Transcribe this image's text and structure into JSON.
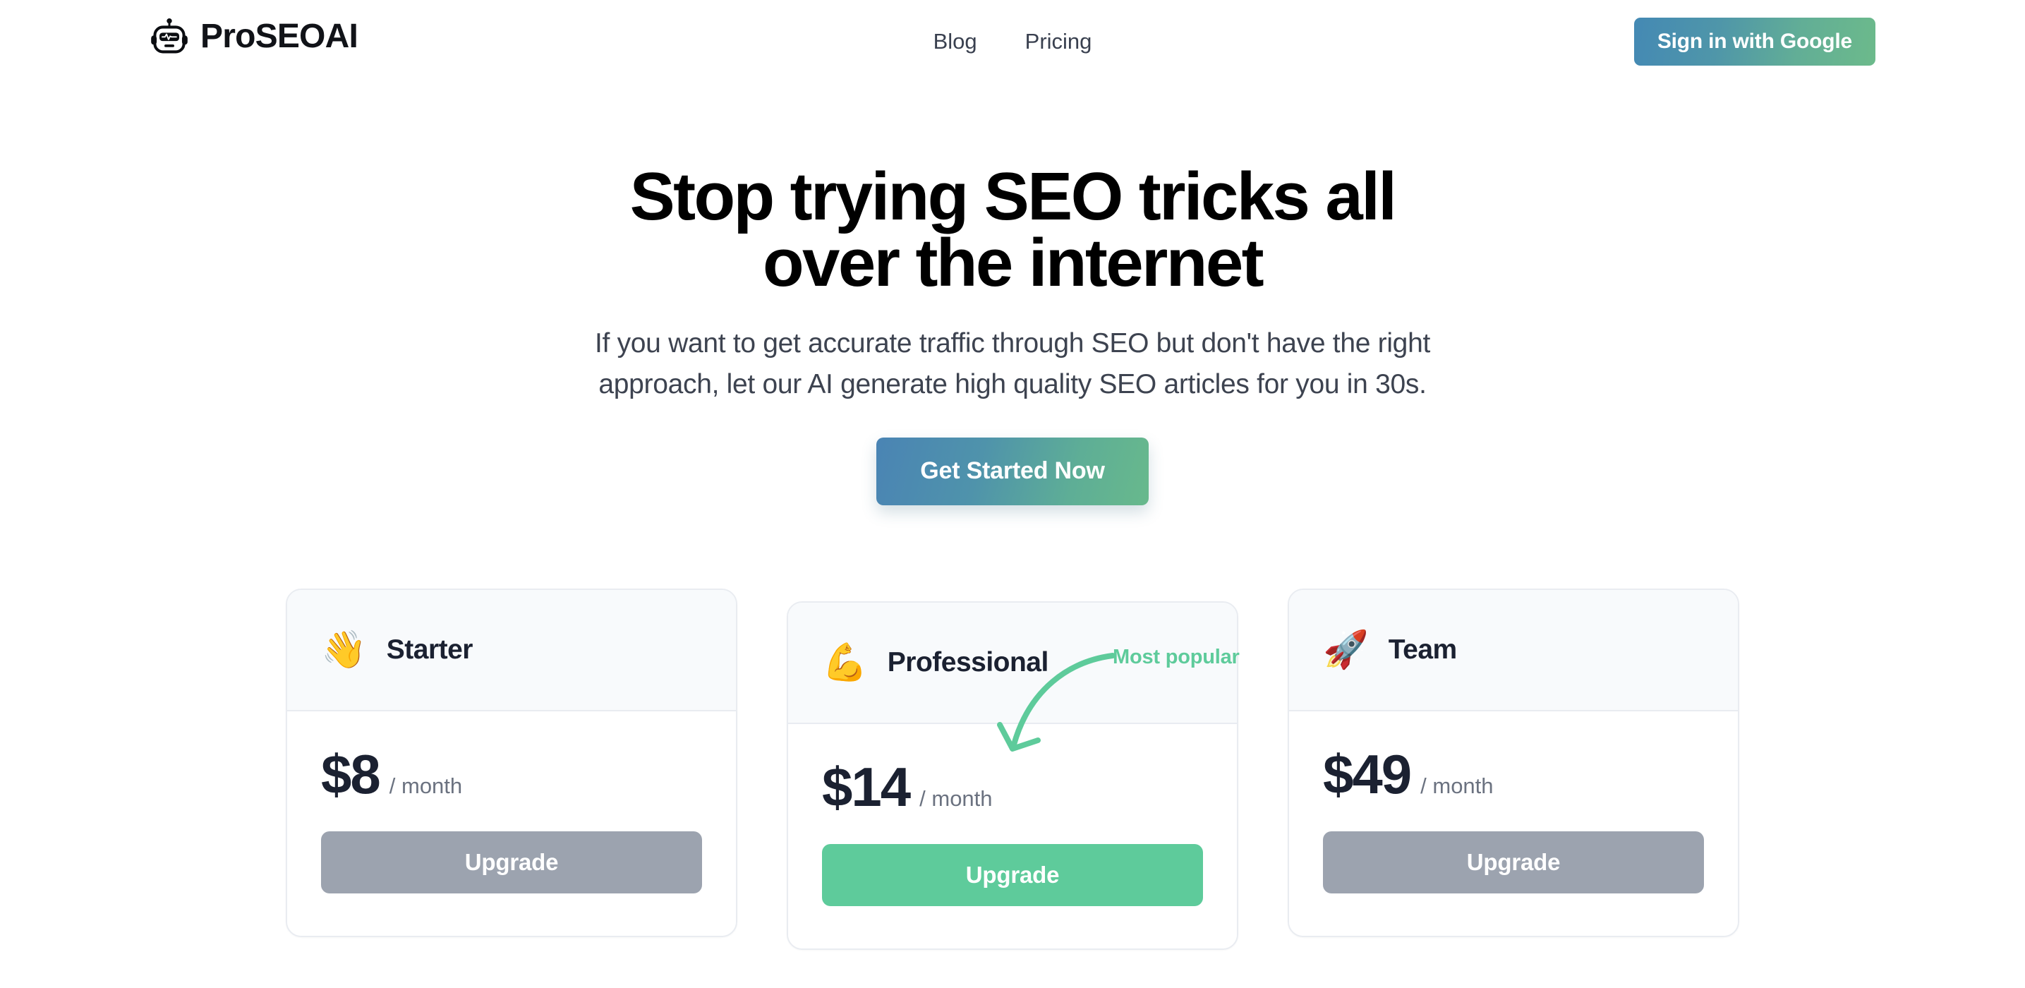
{
  "brand": {
    "name": "ProSEOAI",
    "logo_icon": "robot-head-icon"
  },
  "header": {
    "nav": [
      {
        "label": "Blog"
      },
      {
        "label": "Pricing"
      }
    ],
    "signin_label": "Sign in with Google"
  },
  "hero": {
    "title": "Stop trying SEO tricks all over the internet",
    "subtitle": "If you want to get accurate traffic through SEO but don't have the right approach, let our AI generate high quality SEO articles for you in 30s.",
    "cta_label": "Get Started Now"
  },
  "pricing": {
    "popular_badge": "Most popular",
    "plans": [
      {
        "emoji": "👋",
        "emoji_name": "waving-hand-emoji",
        "name": "Starter",
        "price": "$8",
        "period": "/ month",
        "button_label": "Upgrade",
        "featured": false
      },
      {
        "emoji": "💪",
        "emoji_name": "flexed-biceps-emoji",
        "name": "Professional",
        "price": "$14",
        "period": "/ month",
        "button_label": "Upgrade",
        "featured": true
      },
      {
        "emoji": "🚀",
        "emoji_name": "rocket-emoji",
        "name": "Team",
        "price": "$49",
        "period": "/ month",
        "button_label": "Upgrade",
        "featured": false
      }
    ]
  },
  "colors": {
    "gradient_start": "#4a84b4",
    "gradient_end": "#68b98c",
    "accent_green": "#5ecb9b",
    "muted_button": "#9ca3af",
    "card_header_bg": "#f8fafc",
    "card_border": "#e9ecf1",
    "text_dark": "#1b2131",
    "text_muted": "#6b7280"
  }
}
